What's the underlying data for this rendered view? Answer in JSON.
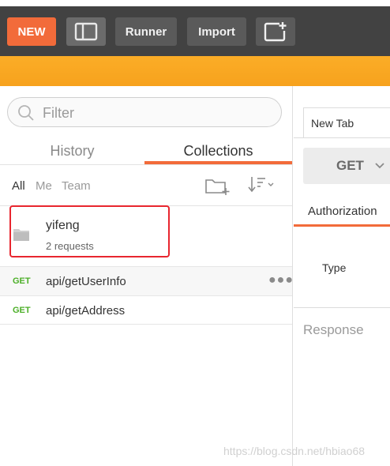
{
  "toolbar": {
    "new_label": "NEW",
    "runner_label": "Runner",
    "import_label": "Import"
  },
  "sidebar": {
    "filter_placeholder": "Filter",
    "tabs": [
      {
        "label": "History",
        "active": false
      },
      {
        "label": "Collections",
        "active": true
      }
    ],
    "scopes": [
      {
        "label": "All",
        "active": true
      },
      {
        "label": "Me",
        "active": false
      },
      {
        "label": "Team",
        "active": false
      }
    ],
    "collection": {
      "name": "yifeng",
      "count": "2 requests"
    },
    "requests": [
      {
        "method": "GET",
        "name": "api/getUserInfo"
      },
      {
        "method": "GET",
        "name": "api/getAddress"
      }
    ]
  },
  "request_panel": {
    "tab_label": "New Tab",
    "method": "GET",
    "auth_tab": "Authorization",
    "type_label": "Type",
    "response_label": "Response"
  },
  "watermark": "https://blog.csdn.net/hbiao68",
  "colors": {
    "accent": "#f26b3a",
    "toolbar": "#424242",
    "banner": "#f9a825",
    "get_method": "#4caf28",
    "highlight": "#e8262f"
  }
}
